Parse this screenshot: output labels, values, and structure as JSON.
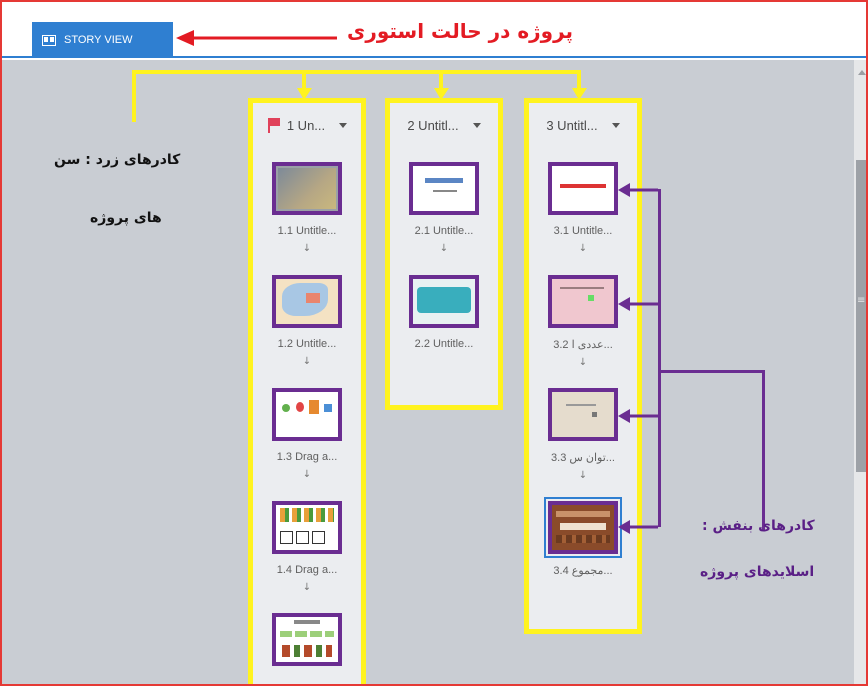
{
  "toolbar": {
    "story_view_label": "STORY VIEW"
  },
  "annotations": {
    "mode_label": "پروژه در حالت استوری",
    "yellow_line1": "کادرهای زرد : سن",
    "yellow_line2": "های پروژه",
    "purple_line1": "کادرهای بنفش :",
    "purple_line2": "اسلایدهای پروژه"
  },
  "scenes": [
    {
      "title": "1 Un...",
      "slides": [
        "1.1 Untitle...",
        "1.2 Untitle...",
        "1.3 Drag a...",
        "1.4 Drag a...",
        ""
      ]
    },
    {
      "title": "2 Untitl...",
      "slides": [
        "2.1 Untitle...",
        "2.2 Untitle..."
      ]
    },
    {
      "title": "3 Untitl...",
      "slides": [
        "3.1 Untitle...",
        "3.2 عددی ا...",
        "3.3 توان س...",
        "3.4 مجموع..."
      ]
    }
  ],
  "colors": {
    "annotation_red": "#e31b23",
    "scene_yellow": "#fff31f",
    "slide_purple": "#6a2d91",
    "tab_blue": "#2f7fd1"
  }
}
